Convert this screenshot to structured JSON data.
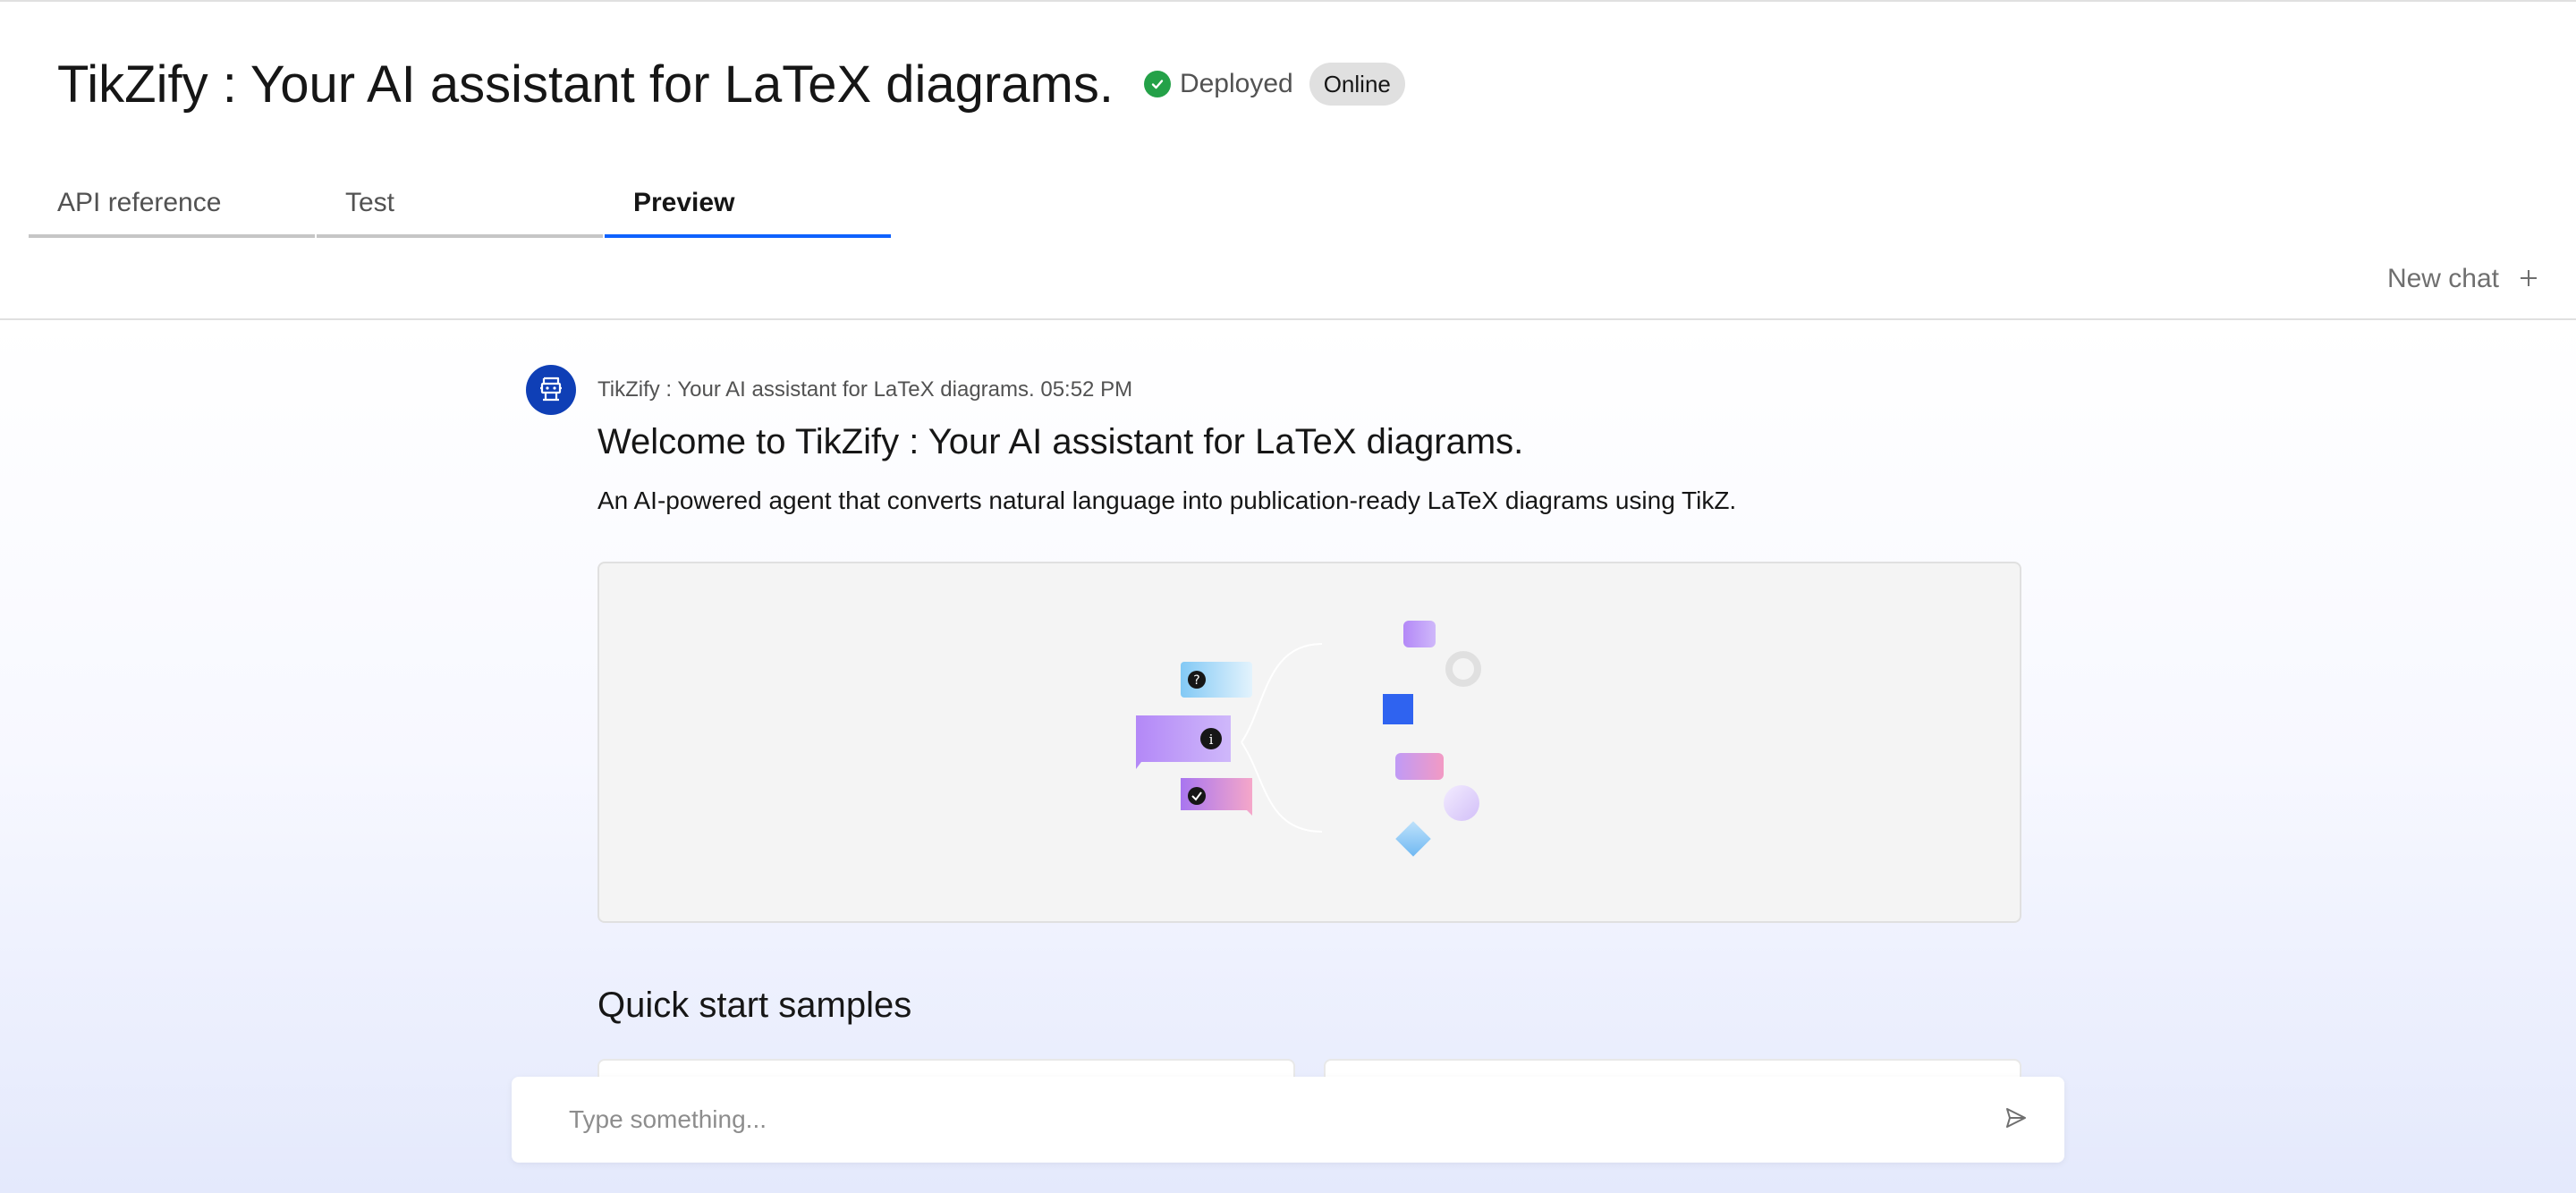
{
  "header": {
    "title": "TikZify : Your AI assistant for LaTeX diagrams.",
    "status_text": "Deployed",
    "status_badge": "Online",
    "status_color": "#24a148"
  },
  "tabs": [
    {
      "label": "API reference",
      "active": false
    },
    {
      "label": "Test",
      "active": false
    },
    {
      "label": "Preview",
      "active": true
    }
  ],
  "toolbar": {
    "new_chat_label": "New chat",
    "new_chat_icon": "plus-icon"
  },
  "message": {
    "avatar_icon": "robot-icon",
    "sender": "TikZify : Your AI assistant for LaTeX diagrams.",
    "time": "05:52 PM",
    "title": "Welcome to TikZify : Your AI assistant for LaTeX diagrams.",
    "description": "An AI-powered agent that converts natural language into publication-ready LaTeX diagrams using TikZ."
  },
  "samples": {
    "title": "Quick start samples"
  },
  "input": {
    "placeholder": "Type something...",
    "value": "",
    "send_icon": "send-icon"
  },
  "colors": {
    "accent": "#0f62fe",
    "avatar_bg": "#0f3fb6"
  }
}
